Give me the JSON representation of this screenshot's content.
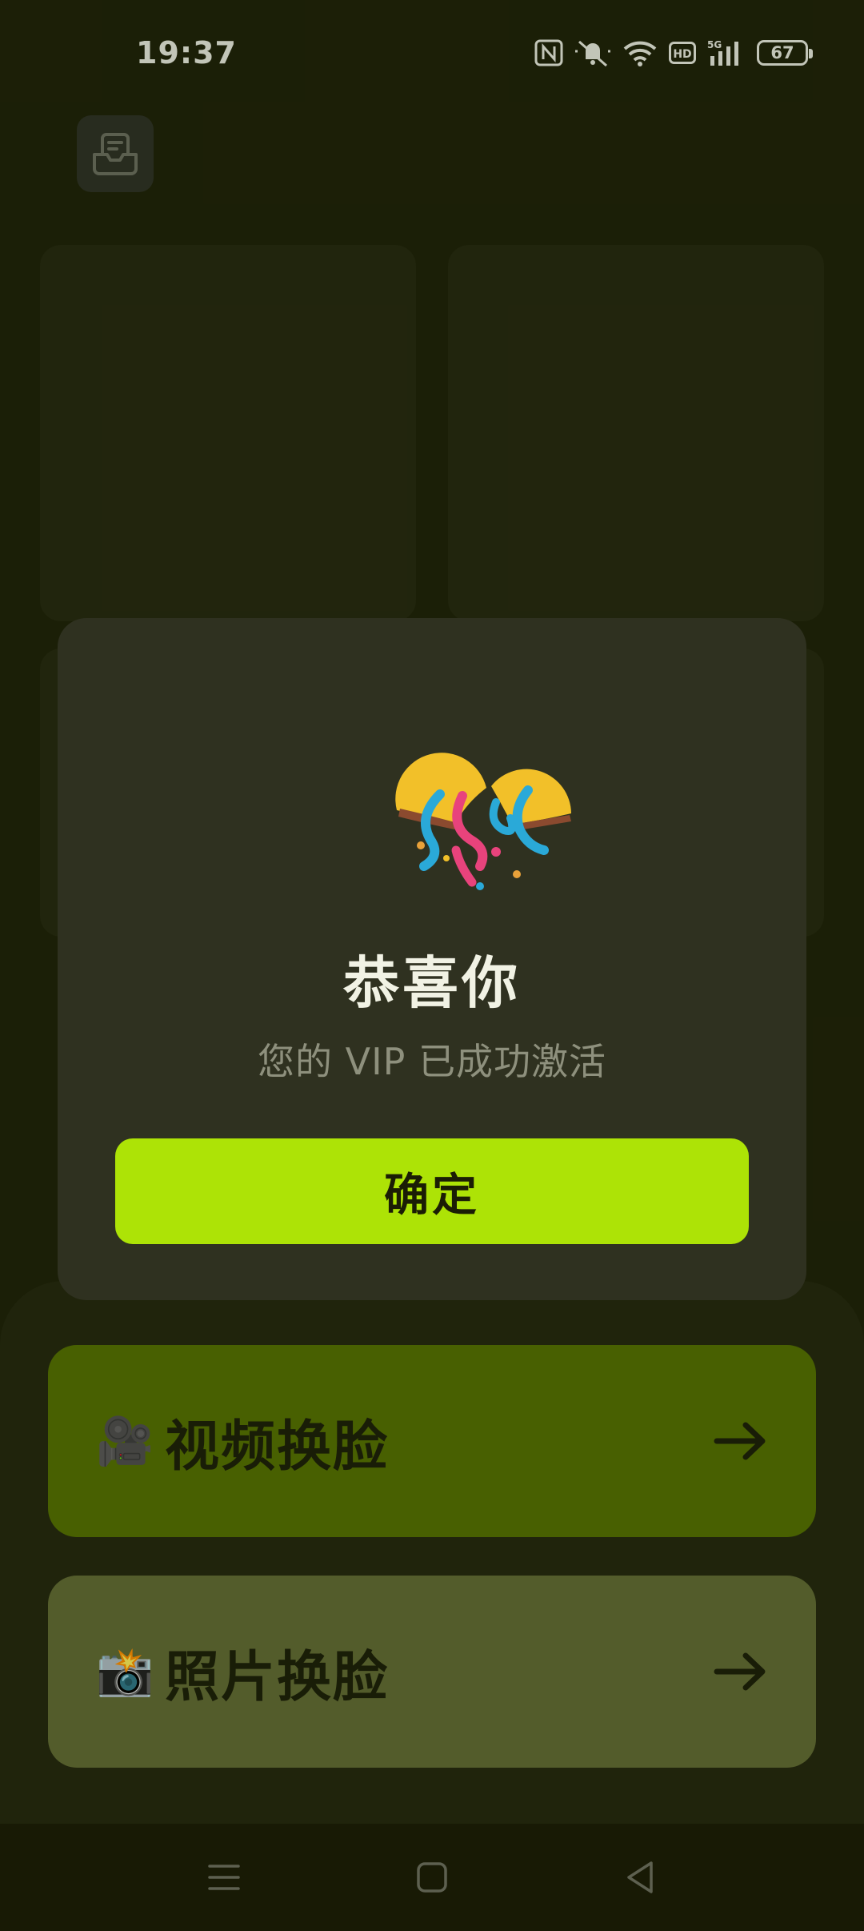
{
  "status_bar": {
    "time": "19:37",
    "battery": "67",
    "icons": [
      "nfc-icon",
      "mute-icon",
      "wifi-icon",
      "hd-icon",
      "5g-signal-icon",
      "battery-icon"
    ]
  },
  "header": {
    "history_icon": "inbox-icon"
  },
  "actions": [
    {
      "emoji": "🎥",
      "label": "视频换脸",
      "arrow": "arrow-right-icon",
      "color": "#557100"
    },
    {
      "emoji": "📸",
      "label": "照片换脸",
      "arrow": "arrow-right-icon",
      "color": "#626c34"
    }
  ],
  "dialog": {
    "icon": "party-popper-icon",
    "title": "恭喜你",
    "subtitle": "您的 VIP 已成功激活",
    "confirm_label": "确定"
  },
  "nav_bar": {
    "items": [
      "menu-icon",
      "home-icon",
      "back-icon"
    ]
  },
  "colors": {
    "accent": "#ade306",
    "background": "#1e2108",
    "dialog": "#2f3120"
  }
}
